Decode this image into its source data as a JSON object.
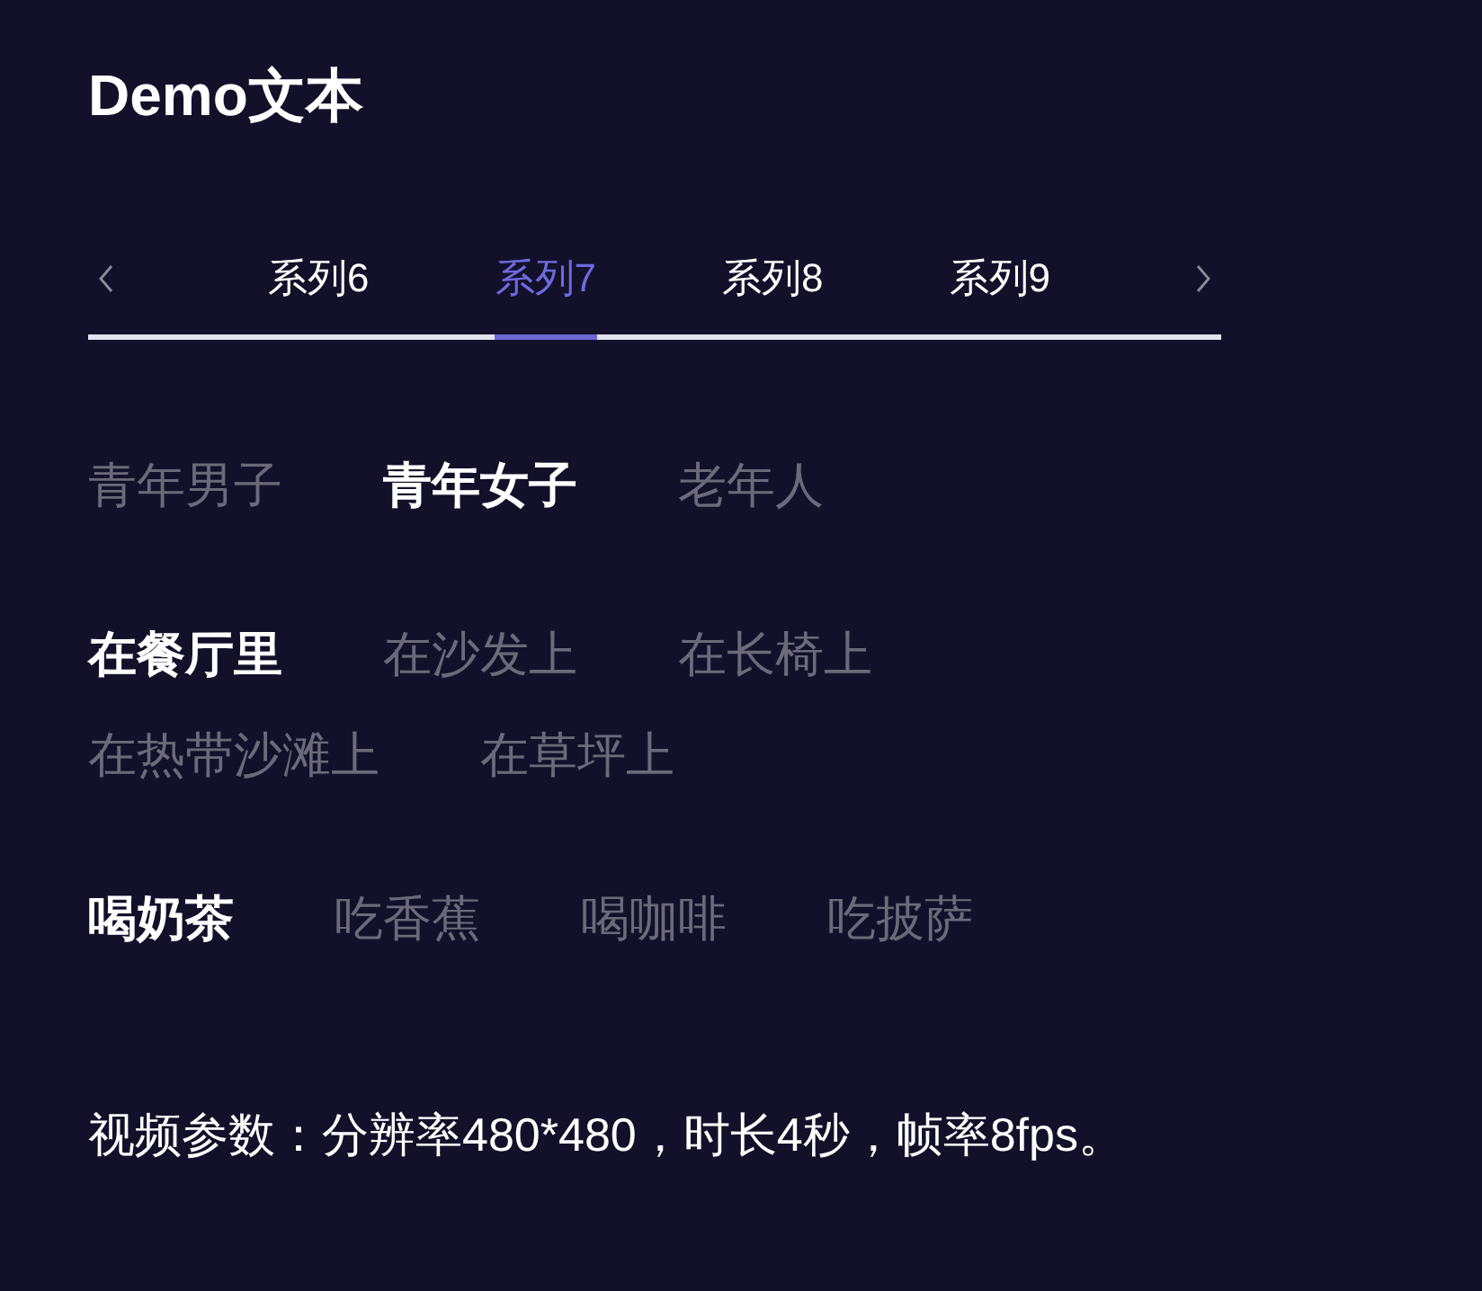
{
  "title": "Demo文本",
  "tabs": [
    {
      "label": "系列6",
      "selected": false
    },
    {
      "label": "系列7",
      "selected": true
    },
    {
      "label": "系列8",
      "selected": false
    },
    {
      "label": "系列9",
      "selected": false
    }
  ],
  "option_groups": [
    {
      "options": [
        {
          "label": "青年男子",
          "selected": false
        },
        {
          "label": "青年女子",
          "selected": true
        },
        {
          "label": "老年人",
          "selected": false
        }
      ]
    },
    {
      "options": [
        {
          "label": "在餐厅里",
          "selected": true
        },
        {
          "label": "在沙发上",
          "selected": false
        },
        {
          "label": "在长椅上",
          "selected": false
        },
        {
          "label": "在热带沙滩上",
          "selected": false
        },
        {
          "label": "在草坪上",
          "selected": false
        }
      ]
    },
    {
      "options": [
        {
          "label": "喝奶茶",
          "selected": true
        },
        {
          "label": "吃香蕉",
          "selected": false
        },
        {
          "label": "喝咖啡",
          "selected": false
        },
        {
          "label": "吃披萨",
          "selected": false
        }
      ]
    }
  ],
  "video_params": "视频参数：分辨率480*480，时长4秒，帧率8fps。"
}
